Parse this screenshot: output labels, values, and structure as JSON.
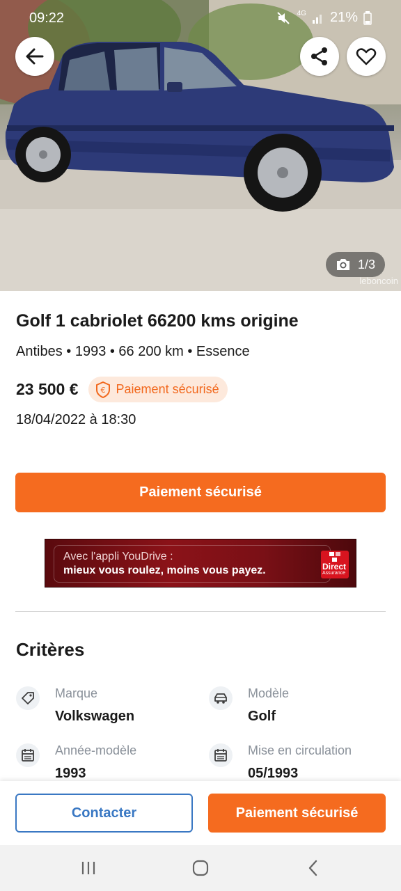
{
  "status_bar": {
    "time": "09:22",
    "network": "4G",
    "battery": "21%"
  },
  "photo": {
    "counter": "1/3",
    "watermark": "leboncoin"
  },
  "listing": {
    "title": "Golf 1 cabriolet 66200 kms origine",
    "subtitle": "Antibes • 1993 • 66 200 km • Essence",
    "price": "23 500 €",
    "secure_badge": "Paiement sécurisé",
    "date": "18/04/2022 à 18:30"
  },
  "primary_button": "Paiement sécurisé",
  "ad": {
    "line1": "Avec l'appli YouDrive :",
    "line2": "mieux vous roulez, moins vous payez.",
    "logo_line1": "Direct",
    "logo_line2": "Assurance"
  },
  "criteria": {
    "title": "Critères",
    "items": [
      {
        "label": "Marque",
        "value": "Volkswagen",
        "icon": "tag-icon"
      },
      {
        "label": "Modèle",
        "value": "Golf",
        "icon": "car-icon"
      },
      {
        "label": "Année-modèle",
        "value": "1993",
        "icon": "calendar-icon"
      },
      {
        "label": "Mise en circulation",
        "value": "05/1993",
        "icon": "calendar-icon"
      }
    ]
  },
  "action_bar": {
    "contact": "Contacter",
    "pay": "Paiement sécurisé"
  },
  "colors": {
    "accent": "#f56b1f",
    "link_blue": "#3a78c3",
    "badge_bg": "#fde9dc"
  }
}
